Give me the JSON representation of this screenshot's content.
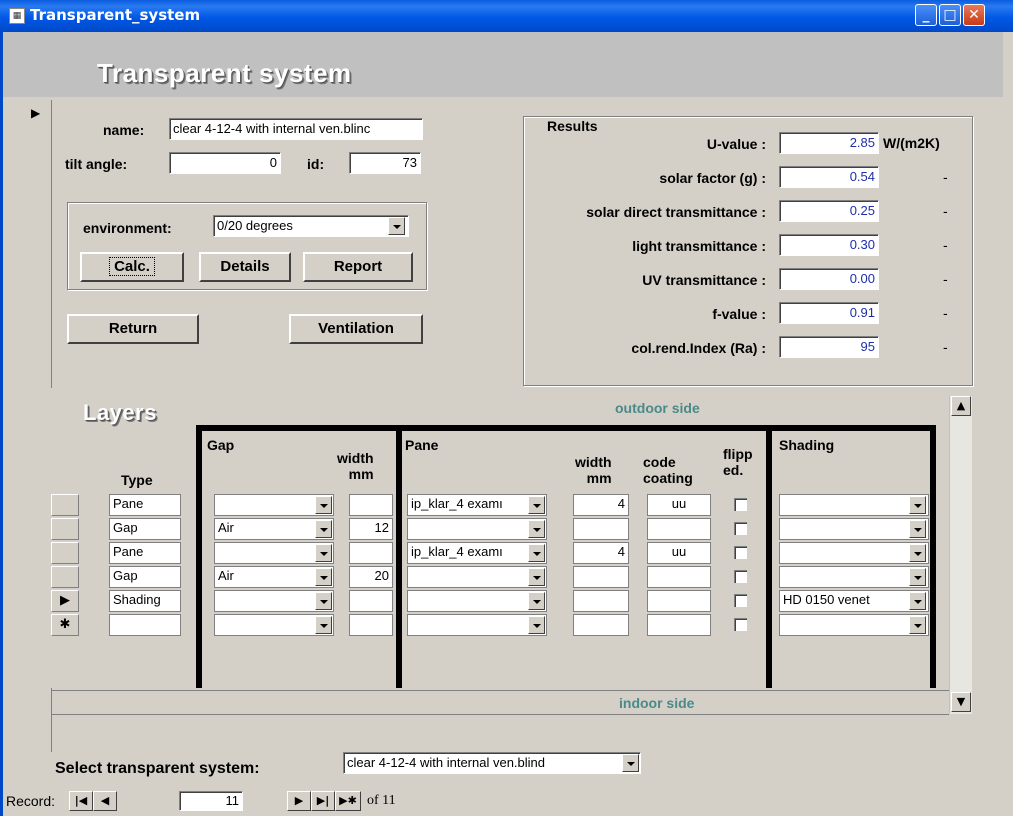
{
  "window": {
    "title": "Transparent_system"
  },
  "header": {
    "title": "Transparent system"
  },
  "fields": {
    "name_label": "name:",
    "name_value": "clear 4-12-4 with internal ven.blinc",
    "tilt_label": "tilt angle:",
    "tilt_value": "0",
    "id_label": "id:",
    "id_value": "73",
    "environment_label": "environment:",
    "environment_value": "0/20 degrees"
  },
  "buttons": {
    "calc": "Calc.",
    "details": "Details",
    "report": "Report",
    "return": "Return",
    "ventilation": "Ventilation"
  },
  "results": {
    "title": "Results",
    "rows": [
      {
        "label": "U-value :",
        "value": "2.85",
        "unit": "W/(m2K)"
      },
      {
        "label": "solar factor (g) :",
        "value": "0.54",
        "unit": "-"
      },
      {
        "label": "solar direct transmittance :",
        "value": "0.25",
        "unit": "-"
      },
      {
        "label": "light  transmittance :",
        "value": "0.30",
        "unit": "-"
      },
      {
        "label": "UV transmittance :",
        "value": "0.00",
        "unit": "-"
      },
      {
        "label": "f-value :",
        "value": "0.91",
        "unit": "-"
      },
      {
        "label": "col.rend.Index (Ra) :",
        "value": "95",
        "unit": "-"
      }
    ]
  },
  "layers": {
    "title": "Layers",
    "outdoor": "outdoor side",
    "indoor": "indoor side",
    "headers": {
      "type": "Type",
      "gap": "Gap",
      "gap_width": "width\nmm",
      "pane": "Pane",
      "pane_width": "width\nmm",
      "code": "code\ncoating",
      "flipped": "flipp\ned.",
      "shading": "Shading"
    },
    "rows": [
      {
        "sel": "",
        "type": "Pane",
        "gap": "",
        "gap_width": "",
        "pane": "ip_klar_4 examı",
        "pane_width": "4",
        "code": "uu",
        "shading": ""
      },
      {
        "sel": "",
        "type": "Gap",
        "gap": "Air",
        "gap_width": "12",
        "pane": "",
        "pane_width": "",
        "code": "",
        "shading": ""
      },
      {
        "sel": "",
        "type": "Pane",
        "gap": "",
        "gap_width": "",
        "pane": "ip_klar_4 examı",
        "pane_width": "4",
        "code": "uu",
        "shading": ""
      },
      {
        "sel": "",
        "type": "Gap",
        "gap": "Air",
        "gap_width": "20",
        "pane": "",
        "pane_width": "",
        "code": "",
        "shading": ""
      },
      {
        "sel": "▶",
        "type": "Shading",
        "gap": "",
        "gap_width": "",
        "pane": "",
        "pane_width": "",
        "code": "",
        "shading": "HD 0150 venet"
      },
      {
        "sel": "✱",
        "type": "",
        "gap": "",
        "gap_width": "",
        "pane": "",
        "pane_width": "",
        "code": "",
        "shading": ""
      }
    ]
  },
  "footer": {
    "select_label": "Select transparent system:",
    "select_value": "clear 4-12-4 with internal ven.blind"
  },
  "navigation": {
    "record_label": "Record:",
    "current": "11",
    "of_text": "of 11"
  }
}
